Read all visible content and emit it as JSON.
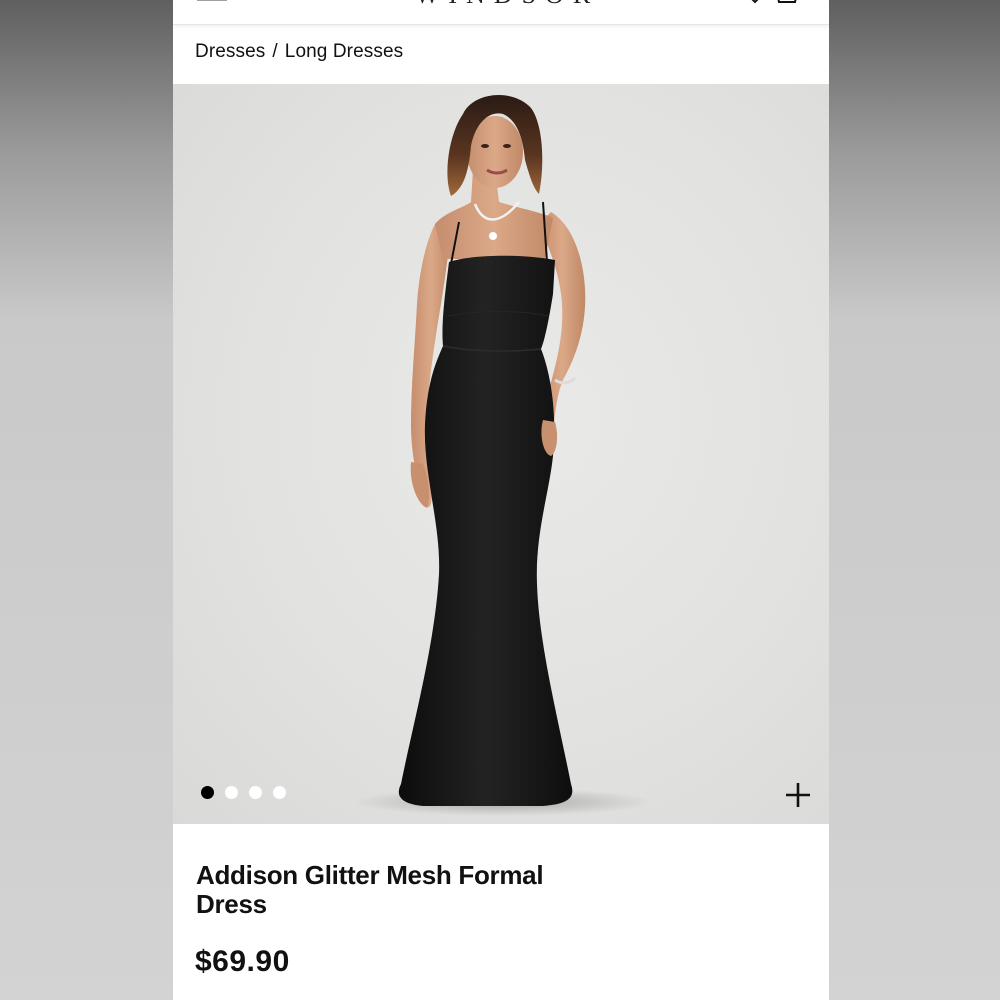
{
  "header": {
    "logo_text": "WINDSOR",
    "menu_icon": "hamburger-menu-icon",
    "bag_icon": "shopping-bag-icon"
  },
  "breadcrumb": {
    "items": [
      "Dresses",
      "Long Dresses"
    ],
    "separator": "/"
  },
  "gallery": {
    "image_count": 4,
    "active_index": 0,
    "zoom_icon": "plus-icon"
  },
  "product": {
    "name": "Addison Glitter Mesh Formal Dress",
    "price": "$69.90"
  },
  "colors": {
    "text": "#111111",
    "dot_active": "#000000",
    "dot_inactive": "#ffffff",
    "hero_background": "#e4e4e2"
  }
}
